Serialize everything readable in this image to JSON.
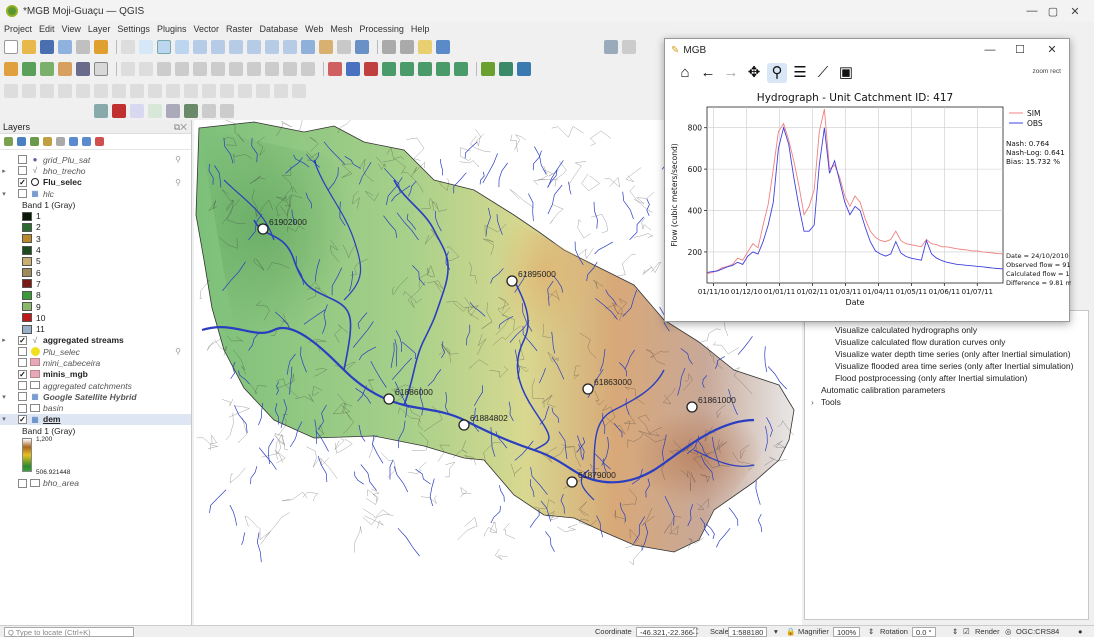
{
  "window": {
    "title": "*MGB Moji-Guaçu — QGIS",
    "minimize": "—",
    "maximize": "▢",
    "close": "✕"
  },
  "menu": [
    "Project",
    "Edit",
    "View",
    "Layer",
    "Settings",
    "Plugins",
    "Vector",
    "Raster",
    "Database",
    "Web",
    "Mesh",
    "Processing",
    "Help"
  ],
  "layers_panel": {
    "title": "Layers",
    "layers": [
      {
        "name": "grid_Plu_sat",
        "checked": false,
        "style": "it",
        "icon": "point"
      },
      {
        "name": "bho_trecho",
        "checked": false,
        "style": "it",
        "icon": "line",
        "expand": "▸"
      },
      {
        "name": "Flu_selec",
        "checked": true,
        "style": "bd",
        "icon": "circle"
      },
      {
        "name": "hlc",
        "checked": false,
        "style": "it",
        "icon": "raster",
        "expand": "▾"
      },
      {
        "name": "Band 1 (Gray)",
        "type": "band"
      },
      {
        "name": "1",
        "type": "class",
        "color": "#0a1a06"
      },
      {
        "name": "2",
        "type": "class",
        "color": "#2e6b30"
      },
      {
        "name": "3",
        "type": "class",
        "color": "#b88a2c"
      },
      {
        "name": "4",
        "type": "class",
        "color": "#1f4a1e"
      },
      {
        "name": "5",
        "type": "class",
        "color": "#c9b070"
      },
      {
        "name": "6",
        "type": "class",
        "color": "#a08c5a"
      },
      {
        "name": "7",
        "type": "class",
        "color": "#7a1a12"
      },
      {
        "name": "8",
        "type": "class",
        "color": "#3a9a3a"
      },
      {
        "name": "9",
        "type": "class",
        "color": "#8ab86a"
      },
      {
        "name": "10",
        "type": "class",
        "color": "#c01818"
      },
      {
        "name": "11",
        "type": "class",
        "color": "#9ab0c8"
      },
      {
        "name": "aggregated streams",
        "checked": true,
        "style": "bd",
        "icon": "line",
        "expand": "▸"
      },
      {
        "name": "Plu_selec",
        "checked": false,
        "style": "it",
        "icon": "yellow"
      },
      {
        "name": "mini_cabeceira",
        "checked": false,
        "style": "it",
        "icon": "pink"
      },
      {
        "name": "minis_mgb",
        "checked": true,
        "style": "bd",
        "icon": "pink"
      },
      {
        "name": "aggregated catchments",
        "checked": false,
        "style": "it",
        "icon": "white"
      },
      {
        "name": "Google Satellite Hybrid",
        "checked": false,
        "style": "it bd",
        "icon": "raster",
        "expand": "▾"
      },
      {
        "name": "basin",
        "checked": false,
        "style": "it",
        "icon": "white"
      },
      {
        "name": "dem",
        "checked": true,
        "style": "bd ul",
        "icon": "raster",
        "expand": "▾",
        "selected": true
      },
      {
        "name": "Band 1 (Gray)",
        "type": "band"
      },
      {
        "name": "1,200",
        "type": "ramp_top"
      },
      {
        "name": "506.921448",
        "type": "ramp_bottom"
      },
      {
        "name": "bho_area",
        "checked": false,
        "style": "it",
        "icon": "white"
      }
    ]
  },
  "map": {
    "stations": [
      {
        "label": "61902000"
      },
      {
        "label": "61895000"
      },
      {
        "label": "61886000"
      },
      {
        "label": "61884802"
      },
      {
        "label": "61863000"
      },
      {
        "label": "61861000"
      },
      {
        "label": "61879000"
      }
    ]
  },
  "right_panel": {
    "items": [
      "Visualize calculated hydrographs only",
      "Visualize calculated flow duration curves only",
      "Visualize water depth time series (only after Inertial simulation)",
      "Visualize flooded area time series (only after Inertial simulation)",
      "Flood postprocessing (only after Inertial simulation)",
      "Automatic calibration parameters",
      "Tools"
    ]
  },
  "mgb_window": {
    "title": "MGB",
    "status": "zoom rect",
    "minimize": "—",
    "maximize": "☐",
    "close": "✕",
    "tools": [
      "home-icon",
      "back-icon",
      "forward-icon",
      "pan-icon",
      "zoom-icon",
      "configure-icon",
      "axes-icon",
      "save-icon"
    ]
  },
  "chart_data": {
    "type": "line",
    "title": "Hydrograph - Unit Catchment ID: 417",
    "xlabel": "Date",
    "ylabel": "Flow (cubic meters/second)",
    "ylim": [
      50,
      900
    ],
    "yticks": [
      200,
      400,
      600,
      800
    ],
    "xticks": [
      "01/11/10",
      "01/12/10",
      "01/01/11",
      "01/02/11",
      "01/03/11",
      "01/04/11",
      "01/05/11",
      "01/06/11",
      "01/07/11"
    ],
    "grid": true,
    "legend_placement": "top-right (outside)",
    "x": [
      0,
      5,
      10,
      15,
      20,
      25,
      30,
      35,
      40,
      45,
      50,
      55,
      60,
      65,
      70,
      75,
      80,
      85,
      90,
      95,
      100,
      105,
      110,
      115,
      120,
      125,
      130,
      135,
      140,
      145,
      150,
      155,
      160,
      165,
      170,
      175,
      180,
      185,
      190,
      195,
      200,
      205,
      210,
      215,
      220,
      225,
      230,
      235,
      240,
      245,
      250,
      255,
      260,
      265,
      270,
      275,
      280,
      285,
      290
    ],
    "series": [
      {
        "name": "SIM",
        "color": "#f08080",
        "values": [
          95,
          100,
          110,
          125,
          130,
          140,
          170,
          160,
          200,
          240,
          220,
          330,
          430,
          600,
          780,
          820,
          740,
          640,
          520,
          380,
          420,
          500,
          780,
          890,
          600,
          620,
          560,
          470,
          420,
          470,
          440,
          360,
          300,
          270,
          255,
          250,
          260,
          300,
          255,
          240,
          235,
          230,
          225,
          260,
          240,
          235,
          225,
          225,
          220,
          215,
          212,
          210,
          205,
          205,
          200,
          198,
          195,
          192,
          190
        ]
      },
      {
        "name": "OBS",
        "color": "#4040e0",
        "values": [
          100,
          105,
          108,
          118,
          128,
          135,
          150,
          140,
          180,
          200,
          190,
          250,
          330,
          440,
          700,
          800,
          720,
          560,
          420,
          300,
          300,
          330,
          620,
          800,
          580,
          640,
          540,
          440,
          380,
          420,
          400,
          320,
          250,
          205,
          190,
          180,
          190,
          250,
          195,
          178,
          170,
          165,
          160,
          255,
          190,
          170,
          158,
          150,
          145,
          140,
          138,
          135,
          133,
          130,
          128,
          125,
          122,
          120,
          118
        ]
      }
    ],
    "stats": {
      "nash": "Nash: 0.764",
      "nash_log": "Nash-Log: 0.641",
      "bias": "Bias: 15.732 %"
    },
    "info": {
      "date": "Date = 24/10/2010",
      "observed": "Observed flow = 91",
      "calculated": "Calculated flow = 1",
      "difference": "Difference = 9.81 m"
    }
  },
  "statusbar": {
    "locate_placeholder": "Q  Type to locate (Ctrl+K)",
    "coordinate_label": "Coordinate",
    "coordinate_value": "-46.321,-22.366",
    "scale_label": "Scale",
    "scale_value": "1:588180",
    "magnifier_label": "Magnifier",
    "magnifier_value": "100%",
    "rotation_label": "Rotation",
    "rotation_value": "0.0 °",
    "render_label": "Render",
    "crs": "OGC:CRS84"
  }
}
